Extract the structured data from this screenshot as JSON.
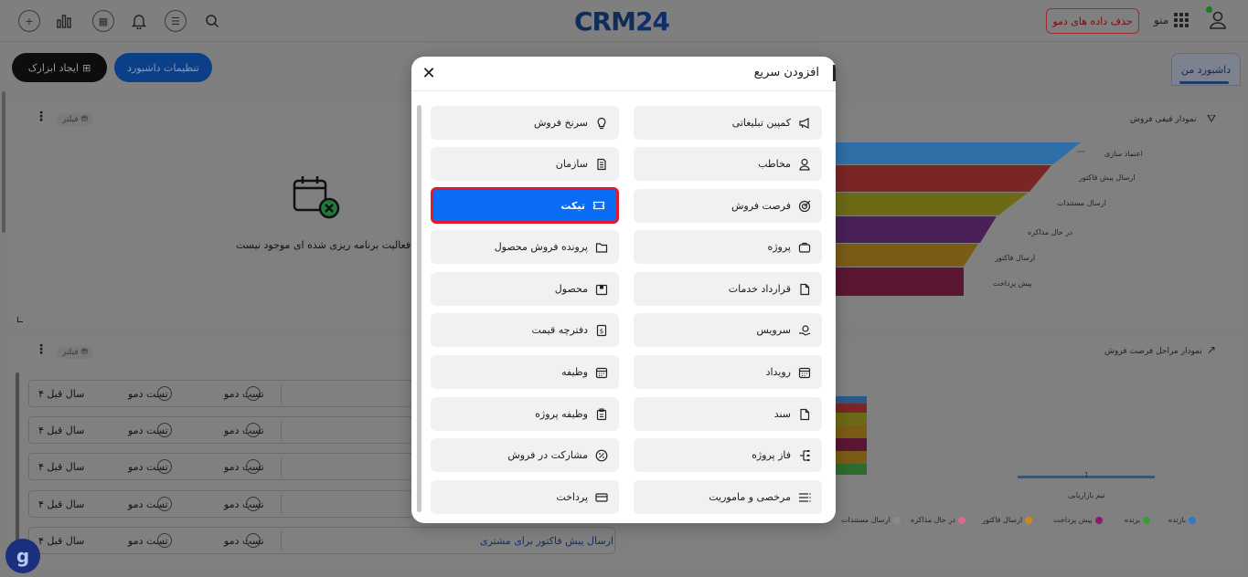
{
  "app": {
    "logo_text": "CRM",
    "logo_number": "24",
    "brand_color": "#0f2d57"
  },
  "topbar": {
    "delete_demo_label": "حذف داده های دمو",
    "menu_label": "منو"
  },
  "toolbar": {
    "create_widget_label": "ایجاد ابزارک",
    "dashboard_settings_label": "تنظیمات داشبورد",
    "my_dashboard_tab": "داشبورد من"
  },
  "panels": {
    "filter_label": "فیلتر",
    "activity_empty_text": "فعالیت برنامه ریزی شده ای موجود نیست",
    "funnel_title": "نمودار قیفی فروش",
    "stages_title": "نمودار مراحل فرصت فروش",
    "funnel_labels": [
      "اعتماد سازی",
      "ارسال پیش فاکتور",
      "ارسال مستندات",
      "در حال مذاکره",
      "ارسال فاکتور",
      "پیش پرداخت"
    ],
    "funnel_colors": [
      "#3a7fbf",
      "#8a2a2a",
      "#7c7a1a",
      "#5a2a6a",
      "#8a6a1a",
      "#6a1a3a"
    ],
    "stages_axis_label": "تیم بازاریابی",
    "stages_value_label": "1",
    "legend": [
      {
        "label": "بازنده",
        "color": "#2f79c8"
      },
      {
        "label": "برنده",
        "color": "#3c9a3c"
      },
      {
        "label": "پیش پرداخت",
        "color": "#8a1a6a"
      },
      {
        "label": "ارسال فاکتور",
        "color": "#c88a1a"
      },
      {
        "label": "در حال مذاکره",
        "color": "#d86a9a"
      },
      {
        "label": "ارسال مستندات",
        "color": "#8a8a8a"
      }
    ]
  },
  "list": {
    "rows": [
      {
        "ago": "۴ سال قبل",
        "user1": "تست دمو",
        "user2": "تست دمو"
      },
      {
        "ago": "۴ سال قبل",
        "user1": "تست دمو",
        "user2": "تست دمو"
      },
      {
        "ago": "۴ سال قبل",
        "user1": "تست دمو",
        "user2": "تست دمو"
      },
      {
        "ago": "۴ سال قبل",
        "user1": "تست دمو",
        "user2": "تست دمو"
      },
      {
        "ago": "۴ سال قبل",
        "user1": "تست دمو",
        "user2": "تست دمو"
      }
    ],
    "last_row_link": "ارسال پیش فاکتور برای مشتری"
  },
  "modal": {
    "title": "افزودن سریع",
    "right_column": [
      {
        "label": "کمپین تبلیغاتی",
        "icon": "megaphone-icon"
      },
      {
        "label": "مخاطب",
        "icon": "person-icon"
      },
      {
        "label": "فرصت فروش",
        "icon": "target-icon"
      },
      {
        "label": "پروژه",
        "icon": "briefcase-icon"
      },
      {
        "label": "قرارداد خدمات",
        "icon": "document-icon"
      },
      {
        "label": "سرویس",
        "icon": "service-hand-icon"
      },
      {
        "label": "رویداد",
        "icon": "calendar-icon"
      },
      {
        "label": "سند",
        "icon": "document-icon"
      },
      {
        "label": "فاز پروژه",
        "icon": "phase-icon"
      },
      {
        "label": "مرخصی و ماموریت",
        "icon": "list-icon"
      }
    ],
    "left_column": [
      {
        "label": "سرنخ فروش",
        "icon": "lightbulb-icon"
      },
      {
        "label": "سازمان",
        "icon": "building-icon"
      },
      {
        "label": "تیکت",
        "icon": "ticket-icon",
        "active": true
      },
      {
        "label": "پرونده فروش محصول",
        "icon": "folder-icon"
      },
      {
        "label": "محصول",
        "icon": "box-icon"
      },
      {
        "label": "دفترچه قیمت",
        "icon": "price-book-icon"
      },
      {
        "label": "وظیفه",
        "icon": "calendar-icon"
      },
      {
        "label": "وظیفه پروژه",
        "icon": "clipboard-icon"
      },
      {
        "label": "مشارکت در فروش",
        "icon": "percent-icon"
      },
      {
        "label": "پرداخت",
        "icon": "card-icon"
      }
    ],
    "active_color": "#0a6cf5",
    "highlight_color": "#e11a2a"
  }
}
